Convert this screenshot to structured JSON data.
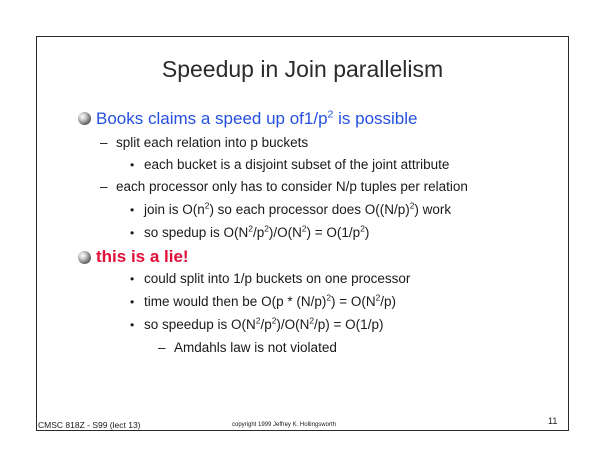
{
  "title": "Speedup in Join parallelism",
  "bullets": {
    "b1": {
      "pre": "Books claims a speed up of1/p",
      "sup": "2",
      "post": " is possible"
    },
    "b1_1": "split each relation into p buckets",
    "b1_1_1": "each bucket is a disjoint subset of the joint attribute",
    "b1_2": "each processor only has to consider N/p tuples per relation",
    "b1_2_1": {
      "a": "join is O(n",
      "s1": "2",
      "b": ") so each processor does O((N/p)",
      "s2": "2",
      "c": ") work"
    },
    "b1_2_2": {
      "a": "so spedup is O(N",
      "s1": "2",
      "b": "/p",
      "s2": "2",
      "c": ")/O(N",
      "s3": "2",
      "d": ") = O(1/p",
      "s4": "2",
      "e": ")"
    },
    "b2": "this is a lie!",
    "b2_1": "could split into 1/p buckets on one processor",
    "b2_2": {
      "a": "time would then be O(p * (N/p)",
      "s1": "2",
      "b": ") = O(N",
      "s2": "2",
      "c": "/p)"
    },
    "b2_3": {
      "a": "so speedup is O(N",
      "s1": "2",
      "b": "/p",
      "s2": "2",
      "c": ")/O(N",
      "s3": "2",
      "d": "/p) = O(1/p)"
    },
    "b2_3_1": "Amdahls law is not violated"
  },
  "symbols": {
    "dash": "–",
    "dot": "•"
  },
  "footer": {
    "left": "CMSC 818Z - S99  (lect 13)",
    "center": "copyright 1999 Jeffrey K. Hollingsworth",
    "page": "11"
  },
  "colors": {
    "blue": "#2450e0",
    "red": "#e0103a"
  }
}
